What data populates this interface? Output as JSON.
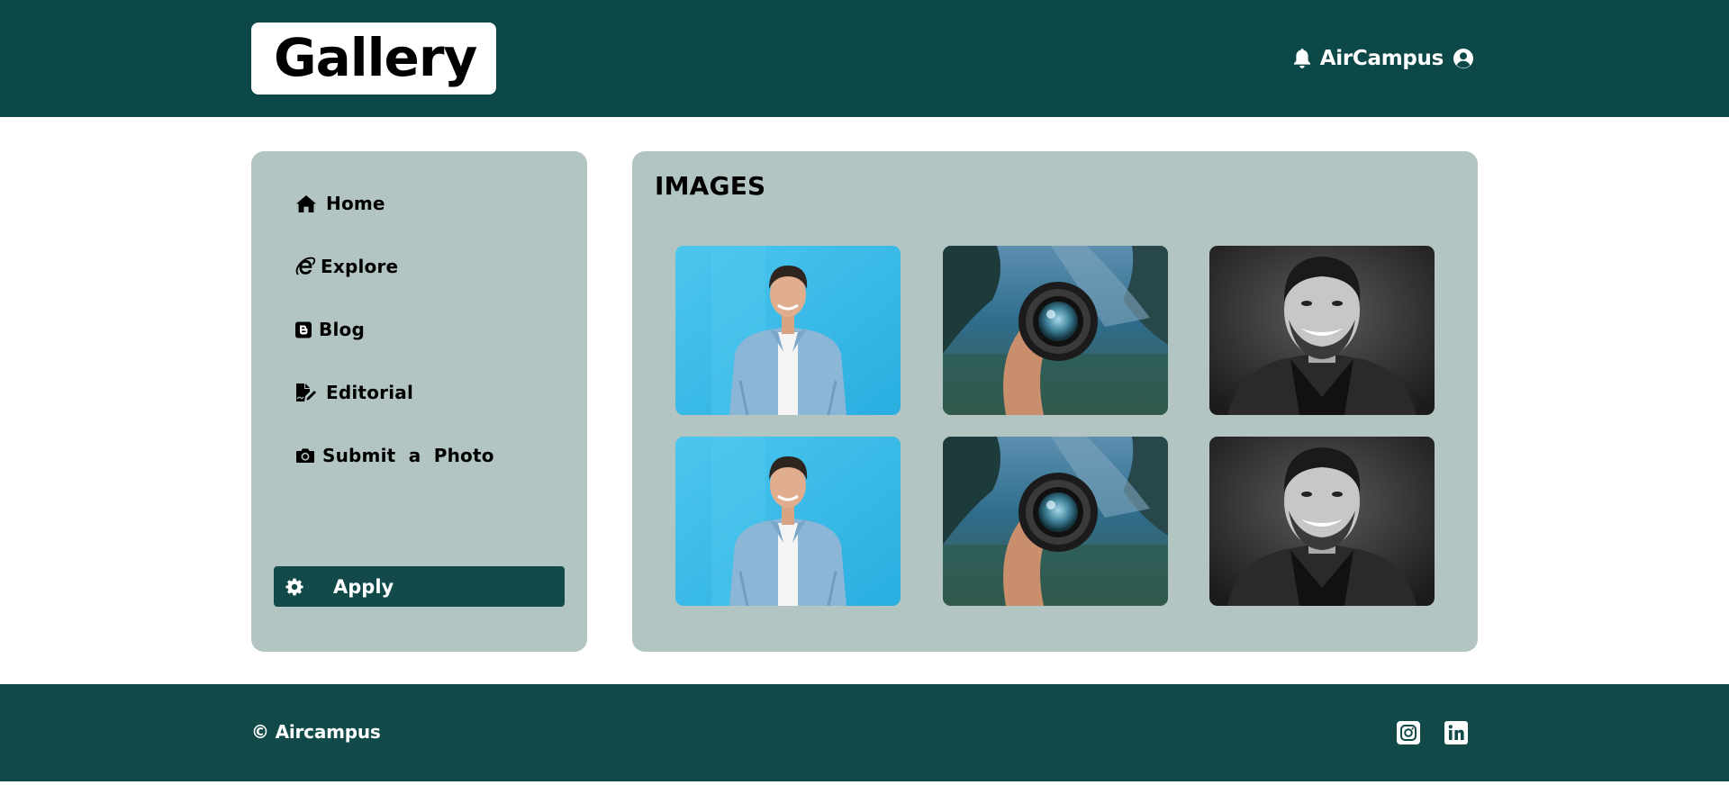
{
  "header": {
    "logo_text": "Gallery",
    "brand_name": "AirCampus",
    "icons": [
      "bell-icon",
      "user-circle-icon"
    ]
  },
  "sidebar": {
    "items": [
      {
        "label": "Home",
        "icon": "home-icon"
      },
      {
        "label": "Explore",
        "icon": "internet-explorer-icon"
      },
      {
        "label": "Blog",
        "icon": "blogger-icon"
      },
      {
        "label": "Editorial",
        "icon": "file-signature-icon"
      },
      {
        "label": "Submit  a  Photo",
        "icon": "camera-icon"
      }
    ],
    "apply_label": "Apply",
    "apply_icon": "gear-icon"
  },
  "main": {
    "title": "IMAGES",
    "images": [
      {
        "subject": "smiling man in denim shirt on blue background"
      },
      {
        "subject": "hand holding camera lens over lake landscape"
      },
      {
        "subject": "black and white portrait of bearded smiling man"
      },
      {
        "subject": "smiling man in denim shirt on blue background"
      },
      {
        "subject": "hand holding camera lens over lake landscape"
      },
      {
        "subject": "black and white portrait of bearded smiling man"
      }
    ]
  },
  "footer": {
    "copyright": "© Aircampus",
    "social": [
      "instagram-icon",
      "linkedin-icon"
    ]
  },
  "colors": {
    "header_bg": "#0d4848",
    "panel_bg": "#b2c5c3",
    "apply_bg": "#124a4a",
    "footer_bg": "#124a4a"
  }
}
